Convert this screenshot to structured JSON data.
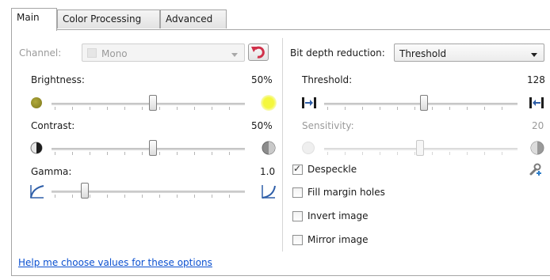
{
  "tabs": [
    {
      "label": "Main",
      "active": true
    },
    {
      "label": "Color Processing",
      "active": false
    },
    {
      "label": "Advanced",
      "active": false
    }
  ],
  "left": {
    "channel": {
      "label": "Channel:",
      "value": "Mono",
      "enabled": false
    },
    "brightness": {
      "label": "Brightness:",
      "value_text": "50%",
      "level": 0.5
    },
    "contrast": {
      "label": "Contrast:",
      "value_text": "50%",
      "level": 0.5
    },
    "gamma": {
      "label": "Gamma:",
      "value_text": "1.0",
      "level": 0.12
    }
  },
  "right": {
    "bit_depth": {
      "label": "Bit depth reduction:",
      "value": "Threshold"
    },
    "threshold": {
      "label": "Threshold:",
      "value_text": "128",
      "level": 0.5
    },
    "sensitivity": {
      "label": "Sensitivity:",
      "value_text": "20",
      "level": 0.5,
      "enabled": false
    },
    "checkboxes": [
      {
        "label": "Despeckle",
        "checked": true
      },
      {
        "label": "Fill margin holes",
        "checked": false
      },
      {
        "label": "Invert image",
        "checked": false
      },
      {
        "label": "Mirror image",
        "checked": false
      }
    ]
  },
  "help_link": "Help me choose values for these options",
  "colors": {
    "link": "#0b50d0",
    "reset_arrow": "#d0314a",
    "brightness_dark": "#8a8420",
    "brightness_light": "#eef238",
    "threshold_icon": "#2e5ea8"
  },
  "icons": {
    "reset": "undo-arrow-icon",
    "despeckle_settings": "wrench-settings-icon"
  }
}
